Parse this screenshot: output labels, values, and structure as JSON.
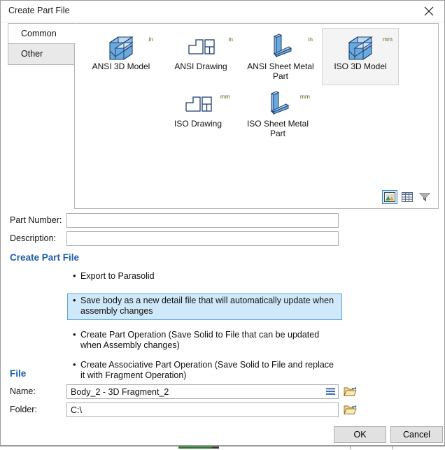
{
  "window": {
    "title": "Create Part File",
    "close_icon": "close-icon"
  },
  "tabs": [
    {
      "label": "Common",
      "selected": true
    },
    {
      "label": "Other",
      "selected": false
    }
  ],
  "templates": [
    {
      "caption": "ANSI 3D Model",
      "unit": "in",
      "icon": "3d-model-icon",
      "selected": false
    },
    {
      "caption": "ANSI Drawing",
      "unit": "in",
      "icon": "drawing-icon",
      "selected": false
    },
    {
      "caption": "ANSI Sheet Metal Part",
      "unit": "in",
      "icon": "sheet-metal-icon",
      "selected": false
    },
    {
      "caption": "ISO 3D Model",
      "unit": "mm",
      "icon": "3d-model-icon",
      "selected": true
    },
    {
      "caption": "ISO Drawing",
      "unit": "mm",
      "icon": "drawing-icon",
      "selected": false
    },
    {
      "caption": "ISO Sheet Metal Part",
      "unit": "mm",
      "icon": "sheet-metal-icon",
      "selected": false
    }
  ],
  "view_modes": [
    {
      "name": "thumbnail-view-icon",
      "active": true
    },
    {
      "name": "grid-view-icon",
      "active": false
    },
    {
      "name": "filter-icon",
      "active": false
    }
  ],
  "fields": {
    "part_number_label": "Part Number:",
    "part_number_value": "",
    "part_number_placeholder": "",
    "description_label": "Description:",
    "description_value": "",
    "description_placeholder": ""
  },
  "create_part_file": {
    "heading": "Create Part File",
    "options": [
      {
        "text": "Export to Parasolid",
        "selected": false
      },
      {
        "text": "Save body as a new detail file that will automatically update when assembly changes",
        "selected": true
      },
      {
        "text": "Create Part Operation (Save Solid to File that can be  updated when Assembly changes)",
        "selected": false
      },
      {
        "text": "Create Associative Part Operation (Save Solid to File and replace it with Fragment Operation)",
        "selected": false
      }
    ]
  },
  "file": {
    "heading": "File",
    "name_label": "Name:",
    "name_value": "Body_2 - 3D Fragment_2",
    "name_list_icon": "list-menu-icon",
    "name_browse_icon": "open-folder-icon",
    "folder_label": "Folder:",
    "folder_value": "C:\\",
    "folder_browse_icon": "open-folder-icon"
  },
  "buttons": {
    "ok": "OK",
    "cancel": "Cancel"
  },
  "colors": {
    "accent_heading": "#1f5fa9",
    "highlight_bg": "#cfe9fa",
    "highlight_border": "#5aa6d8",
    "button_face": "#e1e1e1",
    "icon_blue": "#4f93d4",
    "unit_text": "#6b5a1f"
  }
}
